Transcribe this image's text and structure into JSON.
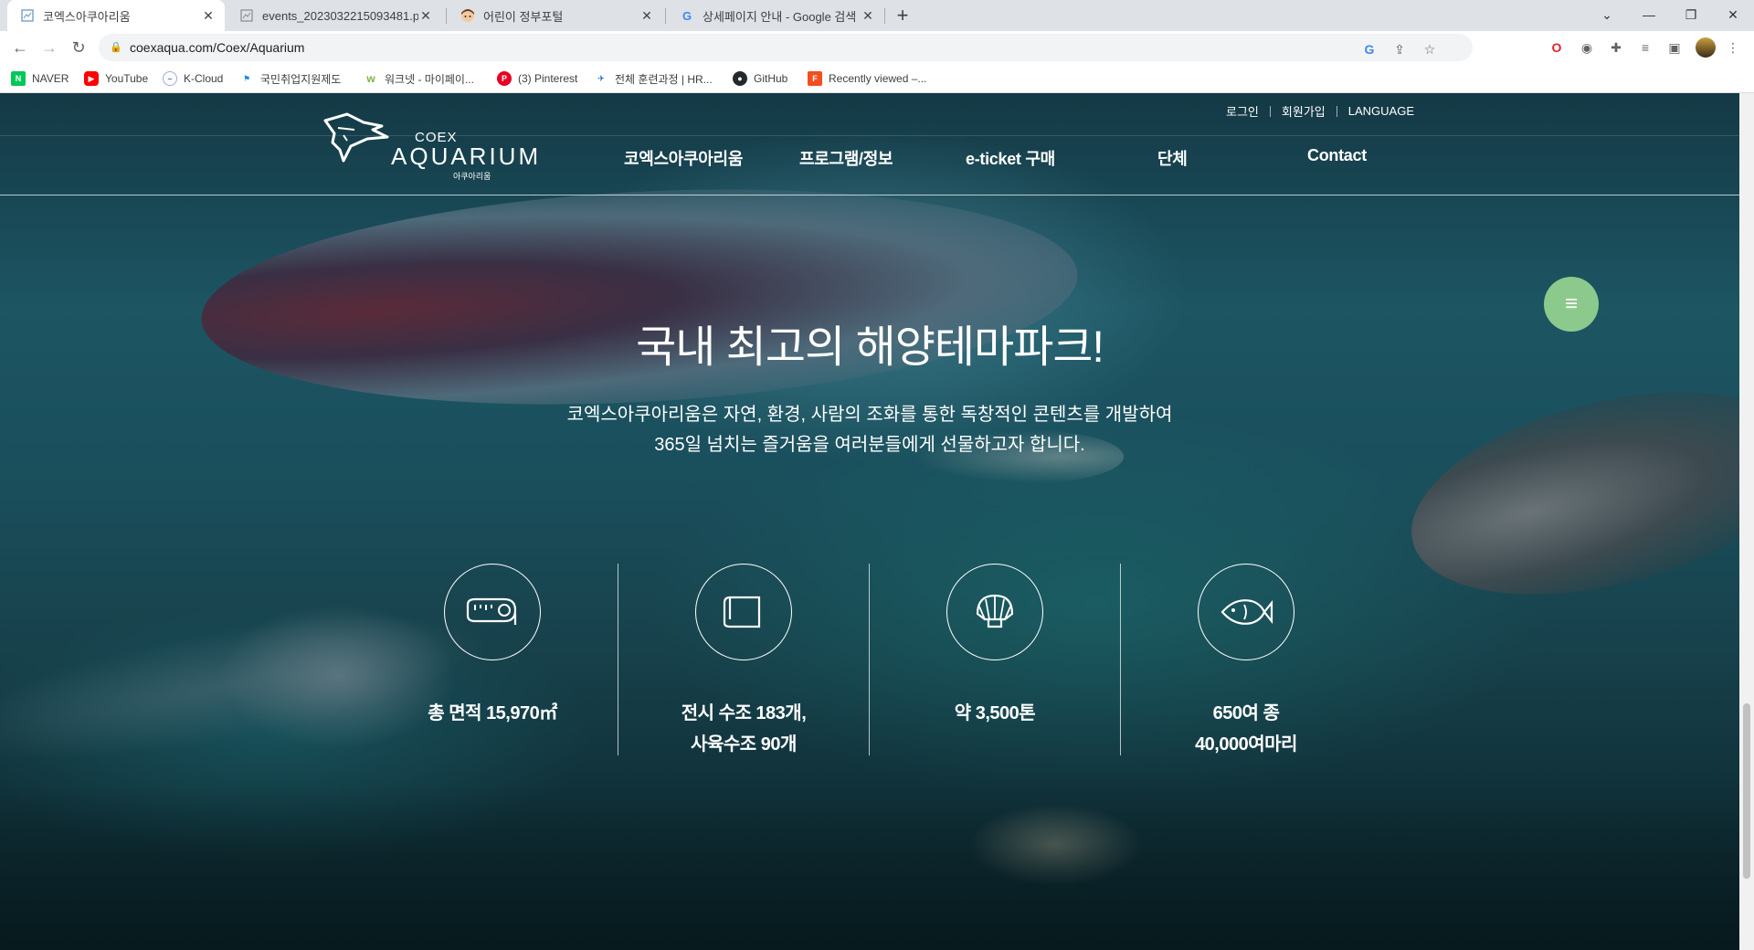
{
  "browser": {
    "tabs": [
      {
        "title": "코엑스아쿠아리움",
        "active": true
      },
      {
        "title": "events_2023032215093481.png",
        "active": false
      },
      {
        "title": "어린이 정부포털",
        "active": false
      },
      {
        "title": "상세페이지 안내 - Google 검색",
        "active": false
      }
    ],
    "new_tab_label": "+",
    "url": "coexaqua.com/Coex/Aquarium",
    "bookmarks": [
      "NAVER",
      "YouTube",
      "K-Cloud",
      "국민취업지원제도",
      "워크넷 - 마이페이...",
      "(3) Pinterest",
      "전체 훈련과정 | HR...",
      "GitHub",
      "Recently viewed –..."
    ]
  },
  "site": {
    "util_nav": [
      "로그인",
      "회원가입",
      "LANGUAGE"
    ],
    "logo": {
      "coex": "COEX",
      "aquarium": "AQUARIUM",
      "korean": "아쿠아리움"
    },
    "gnb": [
      "코엑스아쿠아리움",
      "프로그램/정보",
      "e-ticket 구매",
      "단체",
      "Contact"
    ],
    "hero_title": "국내 최고의 해양테마파크!",
    "hero_desc": [
      "코엑스아쿠아리움은 자연, 환경, 사람의 조화를 통한 독창적인 콘텐츠를 개발하여",
      "365일 넘치는 즐거움을 여러분들에게 선물하고자 합니다."
    ],
    "stats": [
      {
        "icon": "measuring-tape-icon",
        "lines": [
          "총 면적 15,970㎡",
          ""
        ]
      },
      {
        "icon": "scroll-map-icon",
        "lines": [
          "전시 수조 183개,",
          "사육수조 90개"
        ]
      },
      {
        "icon": "shell-icon",
        "lines": [
          "약 3,500톤",
          ""
        ]
      },
      {
        "icon": "fish-icon",
        "lines": [
          "650여 종",
          "40,000여마리"
        ]
      }
    ],
    "menu_button_icon": "hamburger-icon"
  },
  "colors": {
    "fab": "#8cc98c",
    "chrome_bg": "#dee1e6"
  }
}
